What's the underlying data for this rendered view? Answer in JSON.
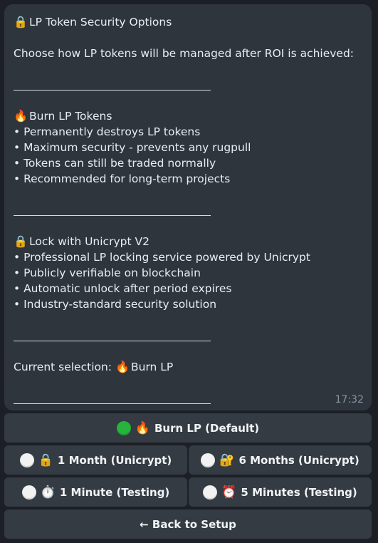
{
  "message": {
    "title": "LP Token Security Options",
    "intro": "Choose how LP tokens will be managed after ROI is achieved:",
    "burn_title": "Burn LP Tokens",
    "burn_points": [
      "• Permanently destroys LP tokens",
      "• Maximum security - prevents any rugpull",
      "• Tokens can still be traded normally",
      "• Recommended for long-term projects"
    ],
    "lock_title": "Lock with Unicrypt V2",
    "lock_points": [
      "• Professional LP locking service powered by Unicrypt",
      "• Publicly verifiable on blockchain",
      "• Automatic unlock after period expires",
      "• Industry-standard security solution"
    ],
    "current_selection_label": "Current selection:",
    "current_selection_value": "Burn LP",
    "timestamp": "17:32"
  },
  "keyboard": {
    "burn_default": "Burn LP (Default)",
    "one_month": "1 Month (Unicrypt)",
    "six_months": "6 Months (Unicrypt)",
    "one_minute": "1 Minute (Testing)",
    "five_minutes": "5 Minutes (Testing)",
    "back": "← Back to Setup"
  },
  "icons": {
    "lock": "lock-icon",
    "fire": "fire-icon",
    "lock_key": "lock-with-key-icon",
    "stopwatch": "stopwatch-icon",
    "alarm": "alarm-clock-icon",
    "green_circle": "green-circle-icon",
    "white_circle": "white-circle-icon"
  },
  "colors": {
    "background": "#1c2026",
    "bubble": "#2f353d",
    "button": "#353b43",
    "selected_dot": "#27b43c"
  }
}
